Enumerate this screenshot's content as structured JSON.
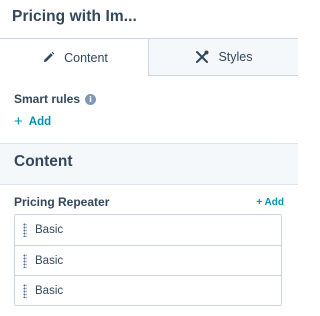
{
  "header": {
    "title": "Pricing with Im..."
  },
  "tabs": [
    {
      "label": "Content",
      "icon": "pencil-icon",
      "active": true
    },
    {
      "label": "Styles",
      "icon": "tools-icon",
      "active": false
    }
  ],
  "smart_rules": {
    "label": "Smart rules",
    "add_label": "Add"
  },
  "section": {
    "title": "Content"
  },
  "repeater": {
    "label": "Pricing Repeater",
    "add_label": "+ Add",
    "items": [
      {
        "label": "Basic"
      },
      {
        "label": "Basic"
      },
      {
        "label": "Basic"
      }
    ]
  },
  "colors": {
    "text": "#33475b",
    "link": "#0091ae",
    "border": "#cbd6e2",
    "inactive_tab_bg": "#f5f8fa"
  }
}
